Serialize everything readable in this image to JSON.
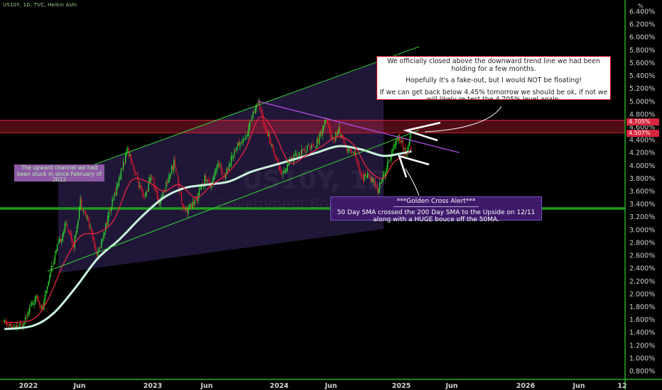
{
  "header": {
    "symbol_line": "US10Y, 1D, TVC, Heikin Ashi",
    "unit": "%"
  },
  "watermark": {
    "ticker": "US10Y, 1D",
    "subtitle": "Government Bonds"
  },
  "colors": {
    "background": "#000000",
    "up_candle": "#2ee82e",
    "down_candle": "#e8182b",
    "sma50": "#e8253f",
    "sma200": "#c9f3dc",
    "channel": "#35d335",
    "resistance_band": "#d11f34",
    "trendline": "#b04ce0",
    "support_line": "#1f9c1f",
    "channel_fill": "#3a2a66"
  },
  "price_tags": [
    {
      "label": "4.705%",
      "value": 4.705
    },
    {
      "label": "4.507%",
      "value": 4.507
    }
  ],
  "annotations": {
    "main_note": [
      "We officially closed above the downward trend line we had been holding for a few months.",
      "Hopefully it's a fake-out, but I would NOT be floating!",
      "If we can get back below 4.45% tomorrow we should be ok, if not we will likely re-test the 4.705% level again."
    ],
    "golden_cross_title": "***Golden Cross Alert***",
    "golden_cross_text": "50 Day SMA crossed the 200 Day SMA to the Upside on 12/11 along with a HUGE bouce off the 50MA.",
    "channel_note": "The upward channel we had been stuck in since February of 2022"
  },
  "chart_data": {
    "type": "candlestick",
    "title": "",
    "xlabel": "",
    "ylabel": "",
    "ylim": [
      0.7,
      6.5
    ],
    "x_ticks": [
      "2022",
      "Jun",
      "2023",
      "Jun",
      "2024",
      "Jun",
      "2025",
      "Jun",
      "2026",
      "Jun",
      "12"
    ],
    "y_ticks": [
      "6.400%",
      "6.200%",
      "6.000%",
      "5.800%",
      "5.600%",
      "5.400%",
      "5.200%",
      "5.000%",
      "4.800%",
      "4.600%",
      "4.400%",
      "4.200%",
      "4.000%",
      "3.800%",
      "3.600%",
      "3.400%",
      "3.200%",
      "3.000%",
      "2.800%",
      "2.600%",
      "2.400%",
      "2.200%",
      "2.000%",
      "1.800%",
      "1.600%",
      "1.400%",
      "1.200%",
      "1.000%",
      "0.800%"
    ],
    "resistance_zone": [
      4.507,
      4.705
    ],
    "support_level": 3.33,
    "price_path": [
      [
        "2021-11-15",
        1.55
      ],
      [
        "2021-12-15",
        1.45
      ],
      [
        "2022-01-01",
        1.5
      ],
      [
        "2022-01-25",
        1.8
      ],
      [
        "2022-02-15",
        1.95
      ],
      [
        "2022-03-01",
        1.75
      ],
      [
        "2022-03-20",
        2.3
      ],
      [
        "2022-04-10",
        2.7
      ],
      [
        "2022-05-06",
        3.1
      ],
      [
        "2022-05-27",
        2.75
      ],
      [
        "2022-06-14",
        3.45
      ],
      [
        "2022-07-10",
        3.05
      ],
      [
        "2022-08-01",
        2.6
      ],
      [
        "2022-08-25",
        3.1
      ],
      [
        "2022-09-20",
        3.6
      ],
      [
        "2022-10-10",
        4.0
      ],
      [
        "2022-10-24",
        4.25
      ],
      [
        "2022-11-10",
        3.95
      ],
      [
        "2022-12-07",
        3.45
      ],
      [
        "2022-12-28",
        3.85
      ],
      [
        "2023-01-18",
        3.4
      ],
      [
        "2023-02-10",
        3.75
      ],
      [
        "2023-03-02",
        4.05
      ],
      [
        "2023-03-24",
        3.4
      ],
      [
        "2023-04-06",
        3.3
      ],
      [
        "2023-05-01",
        3.45
      ],
      [
        "2023-05-26",
        3.8
      ],
      [
        "2023-06-10",
        3.7
      ],
      [
        "2023-07-06",
        4.05
      ],
      [
        "2023-07-18",
        3.8
      ],
      [
        "2023-08-10",
        4.15
      ],
      [
        "2023-08-22",
        4.3
      ],
      [
        "2023-09-20",
        4.45
      ],
      [
        "2023-10-03",
        4.8
      ],
      [
        "2023-10-20",
        4.98
      ],
      [
        "2023-11-10",
        4.6
      ],
      [
        "2023-12-01",
        4.25
      ],
      [
        "2023-12-27",
        3.85
      ],
      [
        "2024-01-15",
        4.05
      ],
      [
        "2024-02-05",
        4.15
      ],
      [
        "2024-03-01",
        4.25
      ],
      [
        "2024-04-01",
        4.35
      ],
      [
        "2024-04-25",
        4.7
      ],
      [
        "2024-05-15",
        4.4
      ],
      [
        "2024-06-01",
        4.55
      ],
      [
        "2024-06-20",
        4.25
      ],
      [
        "2024-07-15",
        4.2
      ],
      [
        "2024-08-05",
        3.8
      ],
      [
        "2024-08-25",
        3.85
      ],
      [
        "2024-09-16",
        3.62
      ],
      [
        "2024-10-01",
        3.8
      ],
      [
        "2024-10-20",
        4.1
      ],
      [
        "2024-11-05",
        4.35
      ],
      [
        "2024-11-15",
        4.45
      ],
      [
        "2024-12-06",
        4.15
      ],
      [
        "2024-12-20",
        4.55
      ]
    ],
    "sma50_path": [
      [
        "2021-11-15",
        1.55
      ],
      [
        "2022-02-01",
        1.6
      ],
      [
        "2022-03-15",
        1.9
      ],
      [
        "2022-05-01",
        2.5
      ],
      [
        "2022-06-15",
        2.9
      ],
      [
        "2022-08-01",
        2.95
      ],
      [
        "2022-09-15",
        3.15
      ],
      [
        "2022-11-01",
        3.75
      ],
      [
        "2022-12-15",
        3.75
      ],
      [
        "2023-02-01",
        3.6
      ],
      [
        "2023-03-15",
        3.7
      ],
      [
        "2023-05-01",
        3.5
      ],
      [
        "2023-06-15",
        3.7
      ],
      [
        "2023-08-01",
        3.9
      ],
      [
        "2023-09-15",
        4.25
      ],
      [
        "2023-10-25",
        4.75
      ],
      [
        "2023-12-01",
        4.55
      ],
      [
        "2024-01-15",
        4.05
      ],
      [
        "2024-03-01",
        4.15
      ],
      [
        "2024-04-15",
        4.3
      ],
      [
        "2024-06-01",
        4.45
      ],
      [
        "2024-07-15",
        4.3
      ],
      [
        "2024-08-20",
        3.95
      ],
      [
        "2024-10-01",
        3.8
      ],
      [
        "2024-11-01",
        4.05
      ],
      [
        "2024-12-11",
        4.2
      ],
      [
        "2024-12-20",
        4.3
      ]
    ],
    "sma200_path": [
      [
        "2021-11-15",
        1.45
      ],
      [
        "2022-02-01",
        1.5
      ],
      [
        "2022-04-01",
        1.7
      ],
      [
        "2022-06-01",
        2.1
      ],
      [
        "2022-08-01",
        2.55
      ],
      [
        "2022-10-01",
        2.85
      ],
      [
        "2022-12-01",
        3.2
      ],
      [
        "2023-02-01",
        3.5
      ],
      [
        "2023-04-01",
        3.65
      ],
      [
        "2023-06-01",
        3.7
      ],
      [
        "2023-08-01",
        3.75
      ],
      [
        "2023-10-01",
        3.9
      ],
      [
        "2023-12-01",
        4.0
      ],
      [
        "2024-02-01",
        4.1
      ],
      [
        "2024-04-01",
        4.2
      ],
      [
        "2024-06-01",
        4.3
      ],
      [
        "2024-08-01",
        4.25
      ],
      [
        "2024-10-01",
        4.15
      ],
      [
        "2024-11-15",
        4.18
      ],
      [
        "2024-12-20",
        4.22
      ]
    ],
    "channel_upper": [
      [
        "2022-03-15",
        3.75
      ],
      [
        "2025-01-10",
        5.85
      ]
    ],
    "channel_lower": [
      [
        "2022-03-15",
        2.35
      ],
      [
        "2025-01-10",
        4.55
      ]
    ],
    "downward_trendline": [
      [
        "2023-10-20",
        5.0
      ],
      [
        "2025-05-01",
        4.2
      ]
    ],
    "grid": false,
    "legend": "none"
  }
}
